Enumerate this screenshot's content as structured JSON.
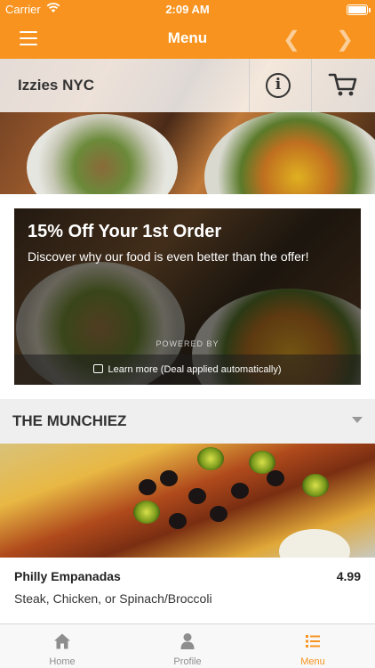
{
  "status_bar": {
    "carrier": "Carrier",
    "time": "2:09 AM",
    "battery_level": 0.95
  },
  "nav": {
    "title": "Menu",
    "back_icon": "chevron-left-icon",
    "forward_icon": "chevron-right-icon"
  },
  "restaurant": {
    "name": "Izzies NYC",
    "info_icon": "info-icon",
    "info_glyph": "i",
    "cart_icon": "cart-icon"
  },
  "promo": {
    "title": "15% Off Your 1st Order",
    "subtitle": "Discover why our food is even better than the offer!",
    "powered_by": "POWERED BY",
    "learn_more": "Learn more (Deal applied automatically)"
  },
  "category": {
    "name": "THE MUNCHIEZ"
  },
  "items": [
    {
      "name": "Philly Empanadas",
      "price": "4.99",
      "description": "Steak, Chicken, or Spinach/Broccoli"
    }
  ],
  "tabs": [
    {
      "label": "Home",
      "icon": "home-icon"
    },
    {
      "label": "Profile",
      "icon": "profile-icon"
    },
    {
      "label": "Menu",
      "icon": "menu-list-icon",
      "active": true
    }
  ],
  "colors": {
    "accent": "#f7931e",
    "category_bg": "#efefef"
  }
}
